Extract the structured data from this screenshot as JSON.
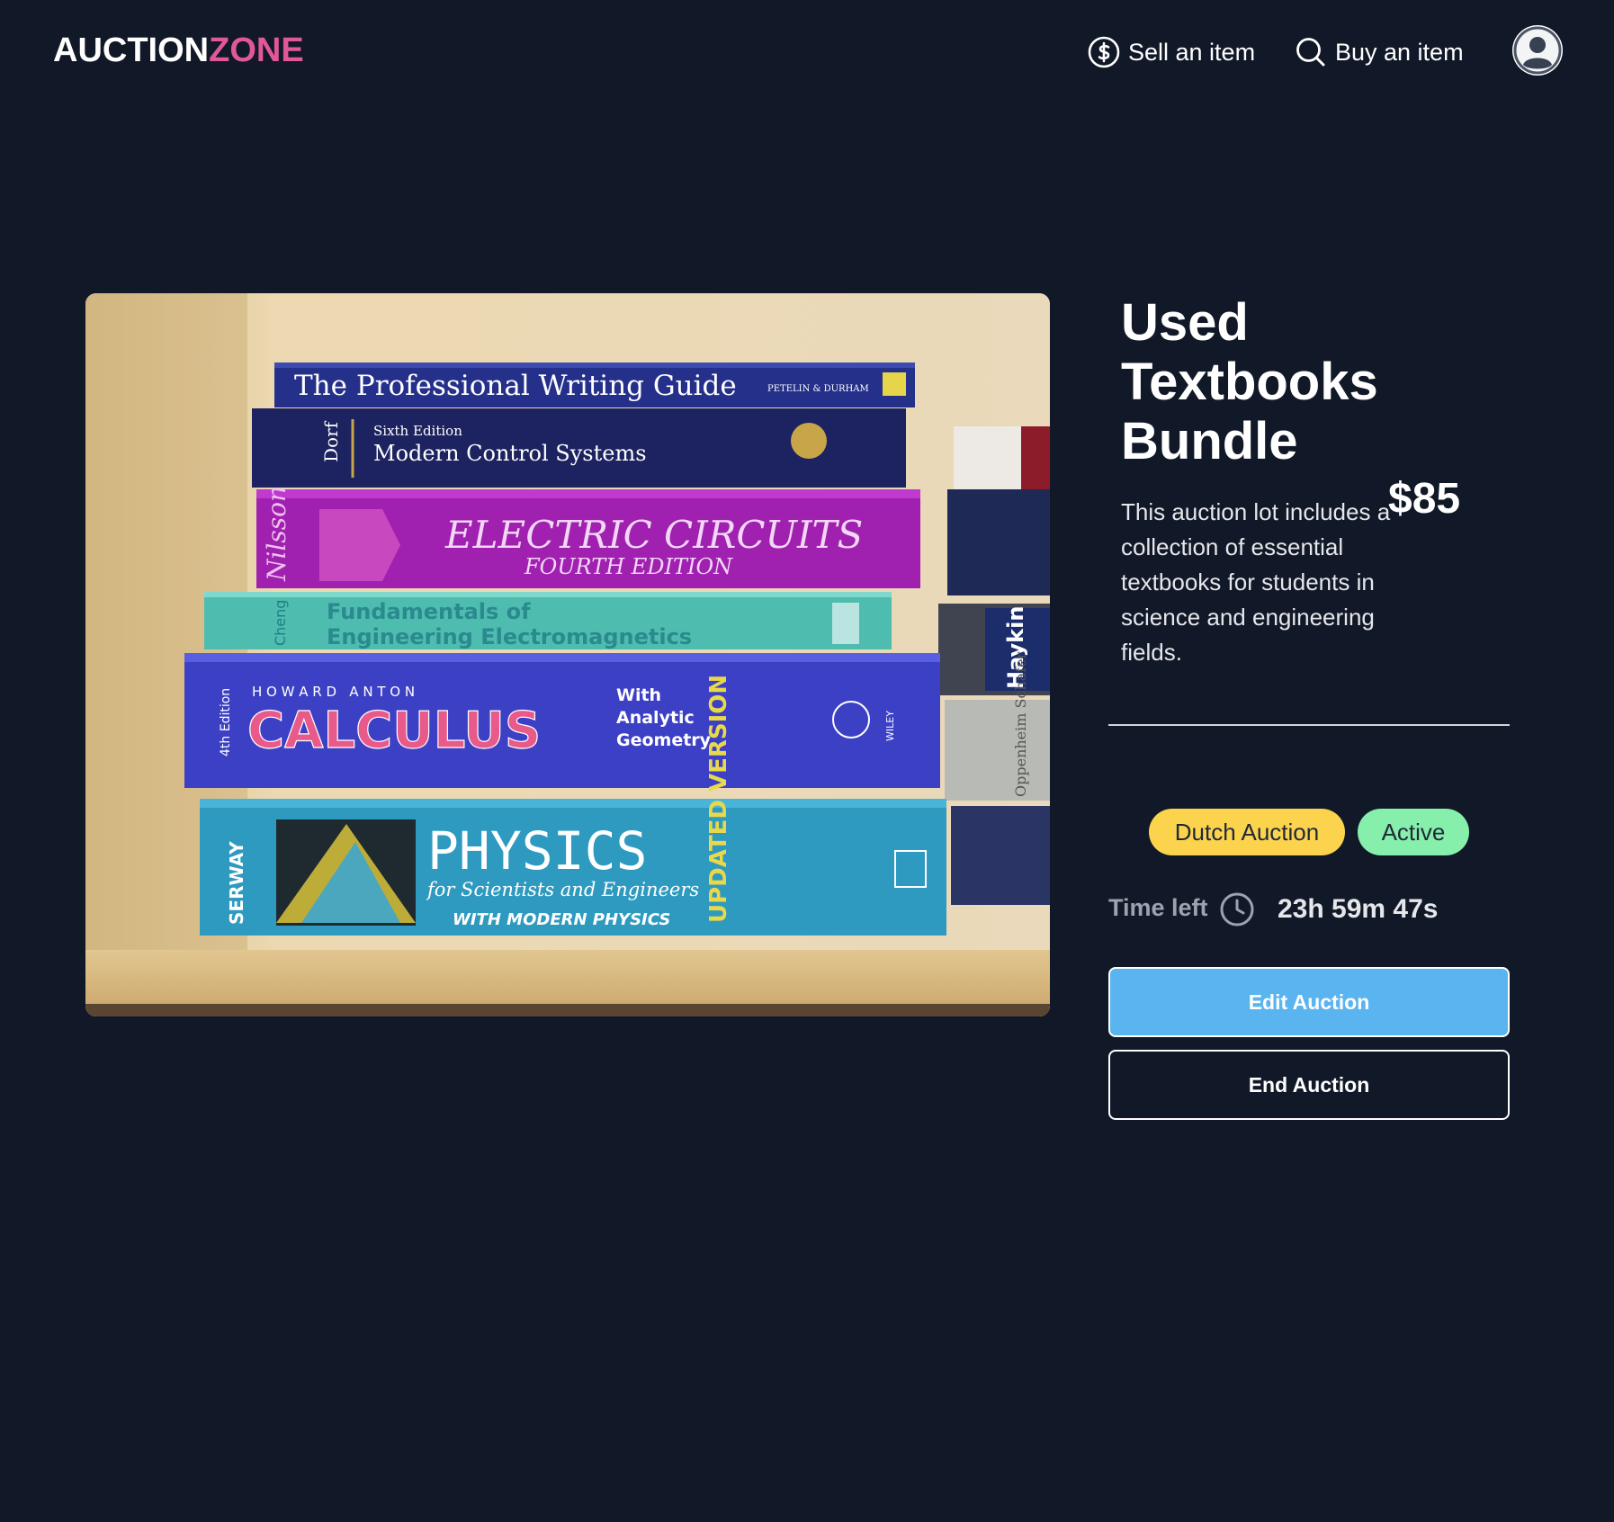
{
  "header": {
    "brand_part1": "AUCTION",
    "brand_part2": "ZONE",
    "brand_accent_color": "#e0589a",
    "nav": [
      {
        "label": "Sell an item",
        "icon": "dollar-circle-icon"
      },
      {
        "label": "Buy an item",
        "icon": "search-icon"
      }
    ],
    "avatar_icon": "user-avatar-icon"
  },
  "listing": {
    "image_alt": "Stack of used textbooks on a shelf",
    "title": "Used Textbooks Bundle",
    "price": "$85",
    "description": "This auction lot includes a collection of essential textbooks for students in science and engineering fields.",
    "badges": {
      "type": "Dutch Auction",
      "status": "Active",
      "type_color": "#fcd34d",
      "status_color": "#86efac"
    },
    "time_left_label": "Time left",
    "time_left_value": "23h 59m 47s",
    "clock_icon": "clock-icon"
  },
  "actions": {
    "edit_label": "Edit Auction",
    "end_label": "End Auction",
    "edit_color": "#5ab4f0"
  },
  "book_spines": {
    "b1_title": "The Professional Writing Guide",
    "b1_author": "PETELIN & DURHAM",
    "b2_edition": "Sixth Edition",
    "b2_title": "Modern Control Systems",
    "b2_author": "Dorf",
    "b3_author": "Nilsson",
    "b3_title": "ELECTRIC CIRCUITS",
    "b3_edition": "FOURTH EDITION",
    "b4_author": "Cheng",
    "b4_title_1": "Fundamentals of",
    "b4_title_2": "Engineering Electromagnetics",
    "b5_author": "H O W A R D   A N T O N",
    "b5_title": "CALCULUS",
    "b5_subtitle_1": "With",
    "b5_subtitle_2": "Analytic",
    "b5_subtitle_3": "Geometry",
    "b5_edition": "4th Edition",
    "b5_publisher": "WILEY",
    "b6_author": "SERWAY",
    "b6_title": "PHYSICS",
    "b6_subtitle": "for Scientists and Engineers",
    "b6_subtitle_2": "WITH MODERN PHYSICS",
    "b6_update": "UPDATED VERSION",
    "side_haykin": "Haykin",
    "side_oppenheim": "Oppenheim Schafer"
  }
}
